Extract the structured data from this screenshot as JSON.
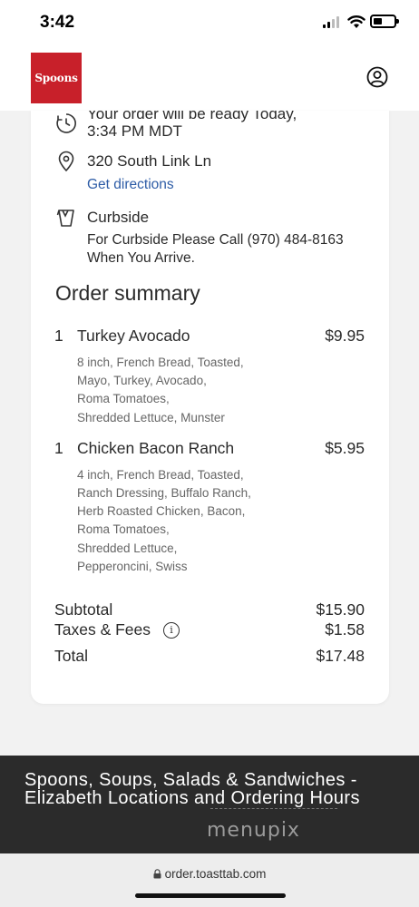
{
  "status_bar": {
    "time": "3:42"
  },
  "header": {
    "logo_text": "Spoons",
    "brand_color": "#c8202a",
    "account_icon": "account-circle-icon"
  },
  "pickup": {
    "time_line1": "Your order will be ready Today,",
    "time_line2": "3:34 PM MDT",
    "address": "320 South Link Ln",
    "directions_link": "Get directions",
    "method": "Curbside",
    "instructions_line1": "For Curbside Please Call (970) 484-8163",
    "instructions_line2": "When You Arrive.",
    "icons": [
      "clock-icon",
      "location-pin-icon",
      "curbside-bag-icon"
    ]
  },
  "order_summary": {
    "title": "Order summary",
    "items": [
      {
        "qty": "1",
        "name": "Turkey Avocado",
        "price": "$9.95",
        "modifiers": [
          "8 inch, French Bread, Toasted,",
          "Mayo, Turkey, Avocado,",
          "Roma Tomatoes,",
          "Shredded Lettuce, Munster"
        ]
      },
      {
        "qty": "1",
        "name": "Chicken Bacon Ranch",
        "price": "$5.95",
        "modifiers": [
          "4 inch, French Bread, Toasted,",
          "Ranch Dressing, Buffalo Ranch,",
          "Herb Roasted Chicken, Bacon,",
          "Roma Tomatoes,",
          "Shredded Lettuce,",
          "Pepperoncini, Swiss"
        ]
      }
    ],
    "subtotal_label": "Subtotal",
    "subtotal_value": "$15.90",
    "taxes_label": "Taxes & Fees",
    "taxes_value": "$1.58",
    "total_label": "Total",
    "total_value": "$17.48"
  },
  "banner": {
    "title": "Spoons, Soups, Salads & Sandwiches - Elizabeth Locations and Ordering Hours",
    "watermark": "menupix"
  },
  "browser": {
    "url": "order.toasttab.com"
  }
}
